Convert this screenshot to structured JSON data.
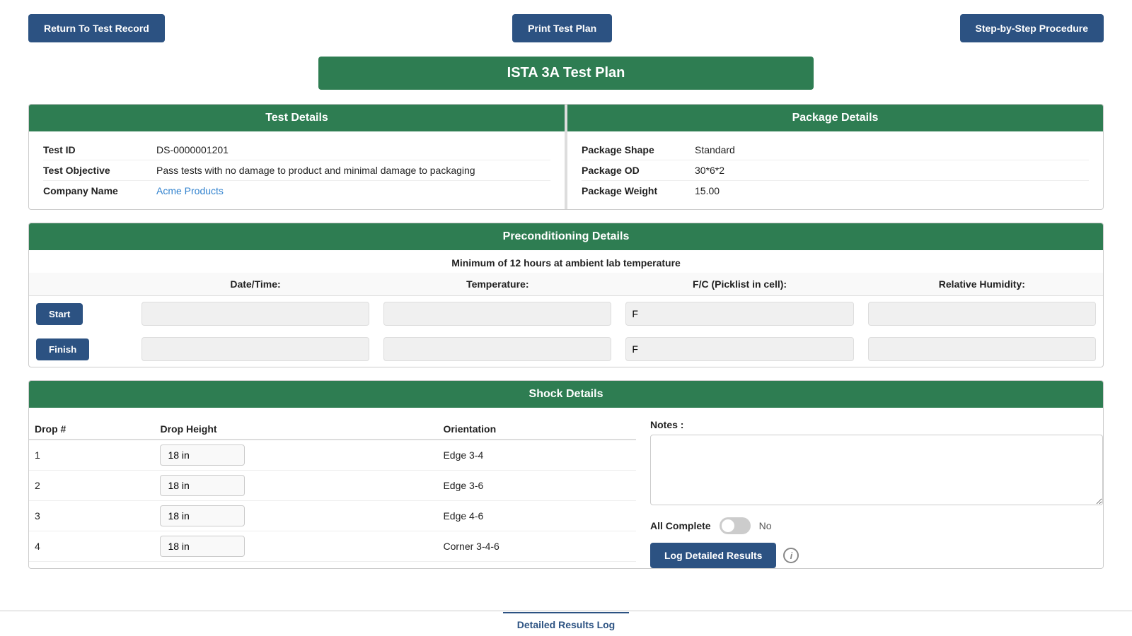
{
  "topBar": {
    "returnBtn": "Return To Test Record",
    "printBtn": "Print Test Plan",
    "stepBtn": "Step-by-Step Procedure"
  },
  "pageTitle": "ISTA 3A Test Plan",
  "testDetails": {
    "header": "Test Details",
    "fields": [
      {
        "label": "Test ID",
        "value": "DS-0000001201",
        "isLink": false
      },
      {
        "label": "Test Objective",
        "value": "Pass tests with no damage to product and minimal damage to packaging",
        "isLink": false
      },
      {
        "label": "Company Name",
        "value": "Acme Products",
        "isLink": true
      }
    ]
  },
  "packageDetails": {
    "header": "Package Details",
    "fields": [
      {
        "label": "Package Shape",
        "value": "Standard"
      },
      {
        "label": "Package OD",
        "value": "30*6*2"
      },
      {
        "label": "Package Weight",
        "value": "15.00"
      }
    ]
  },
  "preconditioning": {
    "header": "Preconditioning Details",
    "note": "Minimum of 12 hours at ambient lab temperature",
    "columns": [
      "Date/Time:",
      "Temperature:",
      "F/C (Picklist in cell):",
      "Relative Humidity:"
    ],
    "rows": [
      {
        "btnLabel": "Start",
        "dateTime": "",
        "temperature": "",
        "fc": "F",
        "humidity": ""
      },
      {
        "btnLabel": "Finish",
        "dateTime": "",
        "temperature": "",
        "fc": "F",
        "humidity": ""
      }
    ]
  },
  "shockDetails": {
    "header": "Shock Details",
    "columns": [
      "Drop #",
      "Drop Height",
      "Orientation"
    ],
    "rows": [
      {
        "drop": "1",
        "height": "18 in",
        "orientation": "Edge 3-4"
      },
      {
        "drop": "2",
        "height": "18 in",
        "orientation": "Edge 3-6"
      },
      {
        "drop": "3",
        "height": "18 in",
        "orientation": "Edge 4-6"
      },
      {
        "drop": "4",
        "height": "18 in",
        "orientation": "Corner 3-4-6"
      }
    ],
    "notesLabel": "Notes :",
    "notesPlaceholder": "",
    "allCompleteLabel": "All Complete",
    "toggleState": false,
    "toggleNoLabel": "No",
    "logBtnLabel": "Log Detailed Results",
    "infoIcon": "i"
  },
  "bottomBar": {
    "tabs": [
      {
        "label": "Detailed Results Log",
        "active": true
      }
    ]
  }
}
